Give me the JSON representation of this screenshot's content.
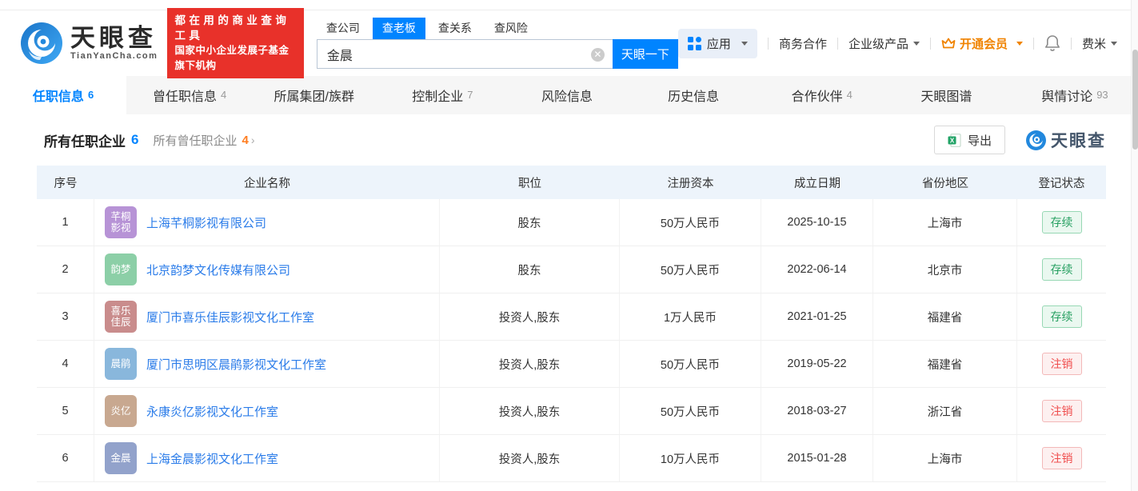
{
  "header": {
    "logo": {
      "title": "天眼查",
      "subtitle": "TianYanCha.com"
    },
    "promo": {
      "line1": "都在用的商业查询工具",
      "line2": "国家中小企业发展子基金旗下机构"
    },
    "search": {
      "tabs": [
        {
          "label": "查公司",
          "active": false
        },
        {
          "label": "查老板",
          "active": true
        },
        {
          "label": "查关系",
          "active": false
        },
        {
          "label": "查风险",
          "active": false
        }
      ],
      "value": "金晨",
      "button": "天眼一下"
    },
    "right": {
      "apps": "应用",
      "business": "商务合作",
      "enterprise": "企业级产品",
      "vip": "开通会员",
      "user": "费米"
    }
  },
  "nav": {
    "tabs": [
      {
        "label": "任职信息",
        "count": "6",
        "active": true
      },
      {
        "label": "曾任职信息",
        "count": "4",
        "active": false
      },
      {
        "label": "所属集团/族群",
        "active": false
      },
      {
        "label": "控制企业",
        "count": "7",
        "active": false
      },
      {
        "label": "风险信息",
        "active": false
      },
      {
        "label": "历史信息",
        "active": false
      },
      {
        "label": "合作伙伴",
        "count": "4",
        "active": false
      },
      {
        "label": "天眼图谱",
        "active": false
      },
      {
        "label": "舆情讨论",
        "count": "93",
        "active": false
      }
    ]
  },
  "section": {
    "title": "所有任职企业",
    "title_count": "6",
    "secondary": "所有曾任职企业",
    "secondary_count": "4",
    "arrow": "›",
    "export_label": "导出",
    "watermark": "天眼查"
  },
  "table": {
    "columns": [
      "序号",
      "企业名称",
      "职位",
      "注册资本",
      "成立日期",
      "省份地区",
      "登记状态"
    ],
    "rows": [
      {
        "index": "1",
        "avatar": "芊桐\n影视",
        "avatar_color": "#b793d6",
        "company": "上海芊桐影视有限公司",
        "position": "股东",
        "capital": "50万人民币",
        "date": "2025-10-15",
        "region": "上海市",
        "status": "存续",
        "status_type": "status-active"
      },
      {
        "index": "2",
        "avatar": "韵梦",
        "avatar_color": "#8ccfa7",
        "company": "北京韵梦文化传媒有限公司",
        "position": "股东",
        "capital": "50万人民币",
        "date": "2022-06-14",
        "region": "北京市",
        "status": "存续",
        "status_type": "status-active"
      },
      {
        "index": "3",
        "avatar": "喜乐\n佳辰",
        "avatar_color": "#c98c8c",
        "company": "厦门市喜乐佳辰影视文化工作室",
        "position": "投资人,股东",
        "capital": "1万人民币",
        "date": "2021-01-25",
        "region": "福建省",
        "status": "存续",
        "status_type": "status-active"
      },
      {
        "index": "4",
        "avatar": "晨鹃",
        "avatar_color": "#89b7dc",
        "company": "厦门市思明区晨鹃影视文化工作室",
        "position": "投资人,股东",
        "capital": "50万人民币",
        "date": "2019-05-22",
        "region": "福建省",
        "status": "注销",
        "status_type": "status-cancelled"
      },
      {
        "index": "5",
        "avatar": "炎亿",
        "avatar_color": "#c8a890",
        "company": "永康炎亿影视文化工作室",
        "position": "投资人,股东",
        "capital": "50万人民币",
        "date": "2018-03-27",
        "region": "浙江省",
        "status": "注销",
        "status_type": "status-cancelled"
      },
      {
        "index": "6",
        "avatar": "金晨",
        "avatar_color": "#92a2cb",
        "company": "上海金晨影视文化工作室",
        "position": "投资人,股东",
        "capital": "10万人民币",
        "date": "2015-01-28",
        "region": "上海市",
        "status": "注销",
        "status_type": "status-cancelled"
      }
    ]
  },
  "colors": {
    "accent_blue": "#0084ff",
    "link_blue": "#2b7ce9",
    "promo_red": "#e8312a",
    "vip_orange": "#f08300",
    "status_green": "#28a062",
    "status_red": "#f04e4e",
    "table_header_bg": "#edf4fb"
  }
}
